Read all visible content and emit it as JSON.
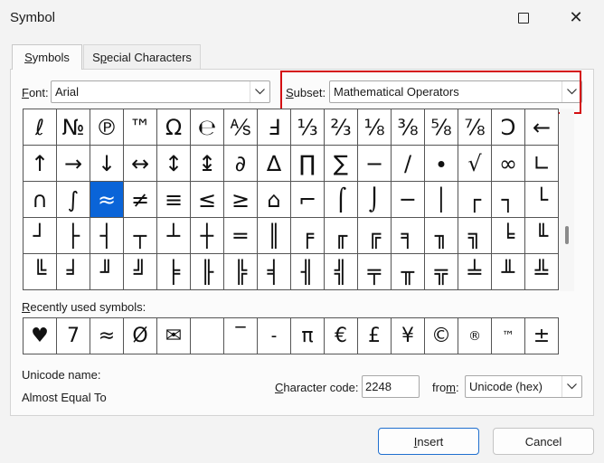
{
  "window": {
    "title": "Symbol"
  },
  "tabs": [
    {
      "label": "Symbols",
      "accel": "S",
      "rest": "ymbols",
      "active": true
    },
    {
      "label": "Special Characters",
      "pre": "S",
      "accel": "p",
      "rest": "ecial Characters",
      "active": false
    }
  ],
  "font": {
    "accel": "F",
    "rest": "ont:",
    "value": "Arial"
  },
  "subset": {
    "pre": "",
    "accel": "S",
    "rest": "ubset:",
    "value": "Mathematical Operators"
  },
  "symbols": [
    [
      "ℓ",
      "№",
      "℗",
      "™",
      "Ω",
      "℮",
      "⅍",
      "Ⅎ",
      "⅓",
      "⅔",
      "⅛",
      "⅜",
      "⅝",
      "⅞",
      "Ↄ",
      "←"
    ],
    [
      "↑",
      "→",
      "↓",
      "↔",
      "↕",
      "↨",
      "∂",
      "∆",
      "∏",
      "∑",
      "−",
      "∕",
      "∙",
      "√",
      "∞",
      "∟"
    ],
    [
      "∩",
      "∫",
      "≈",
      "≠",
      "≡",
      "≤",
      "≥",
      "⌂",
      "⌐",
      "⌠",
      "⌡",
      "─",
      "│",
      "┌",
      "┐",
      "└"
    ],
    [
      "┘",
      "├",
      "┤",
      "┬",
      "┴",
      "┼",
      "═",
      "║",
      "╒",
      "╓",
      "╔",
      "╕",
      "╖",
      "╗",
      "╘",
      "╙"
    ],
    [
      "╚",
      "╛",
      "╜",
      "╝",
      "╞",
      "╟",
      "╠",
      "╡",
      "╢",
      "╣",
      "╤",
      "╥",
      "╦",
      "╧",
      "╨",
      "╩"
    ]
  ],
  "selected": {
    "row": 2,
    "col": 2
  },
  "recent": {
    "accel": "R",
    "rest": "ecently used symbols:",
    "symbols": [
      "♥",
      "7",
      "≈",
      "Ø",
      "✉",
      "",
      "‾",
      "˗",
      "π",
      "€",
      "£",
      "¥",
      "©",
      "®",
      "™",
      "±"
    ]
  },
  "unicode_name": {
    "label": "Unicode name:",
    "value": "Almost Equal To"
  },
  "char_code": {
    "accel": "C",
    "rest": "haracter code:",
    "value": "2248"
  },
  "from": {
    "pre": "fro",
    "accel": "m",
    "rest": ":",
    "value": "Unicode (hex)"
  },
  "buttons": {
    "insert": {
      "accel": "I",
      "rest": "nsert"
    },
    "cancel": {
      "label": "Cancel"
    }
  },
  "colors": {
    "selection": "#0a64d8",
    "highlight": "#d40f12",
    "primary_border": "#1f6fcf"
  }
}
